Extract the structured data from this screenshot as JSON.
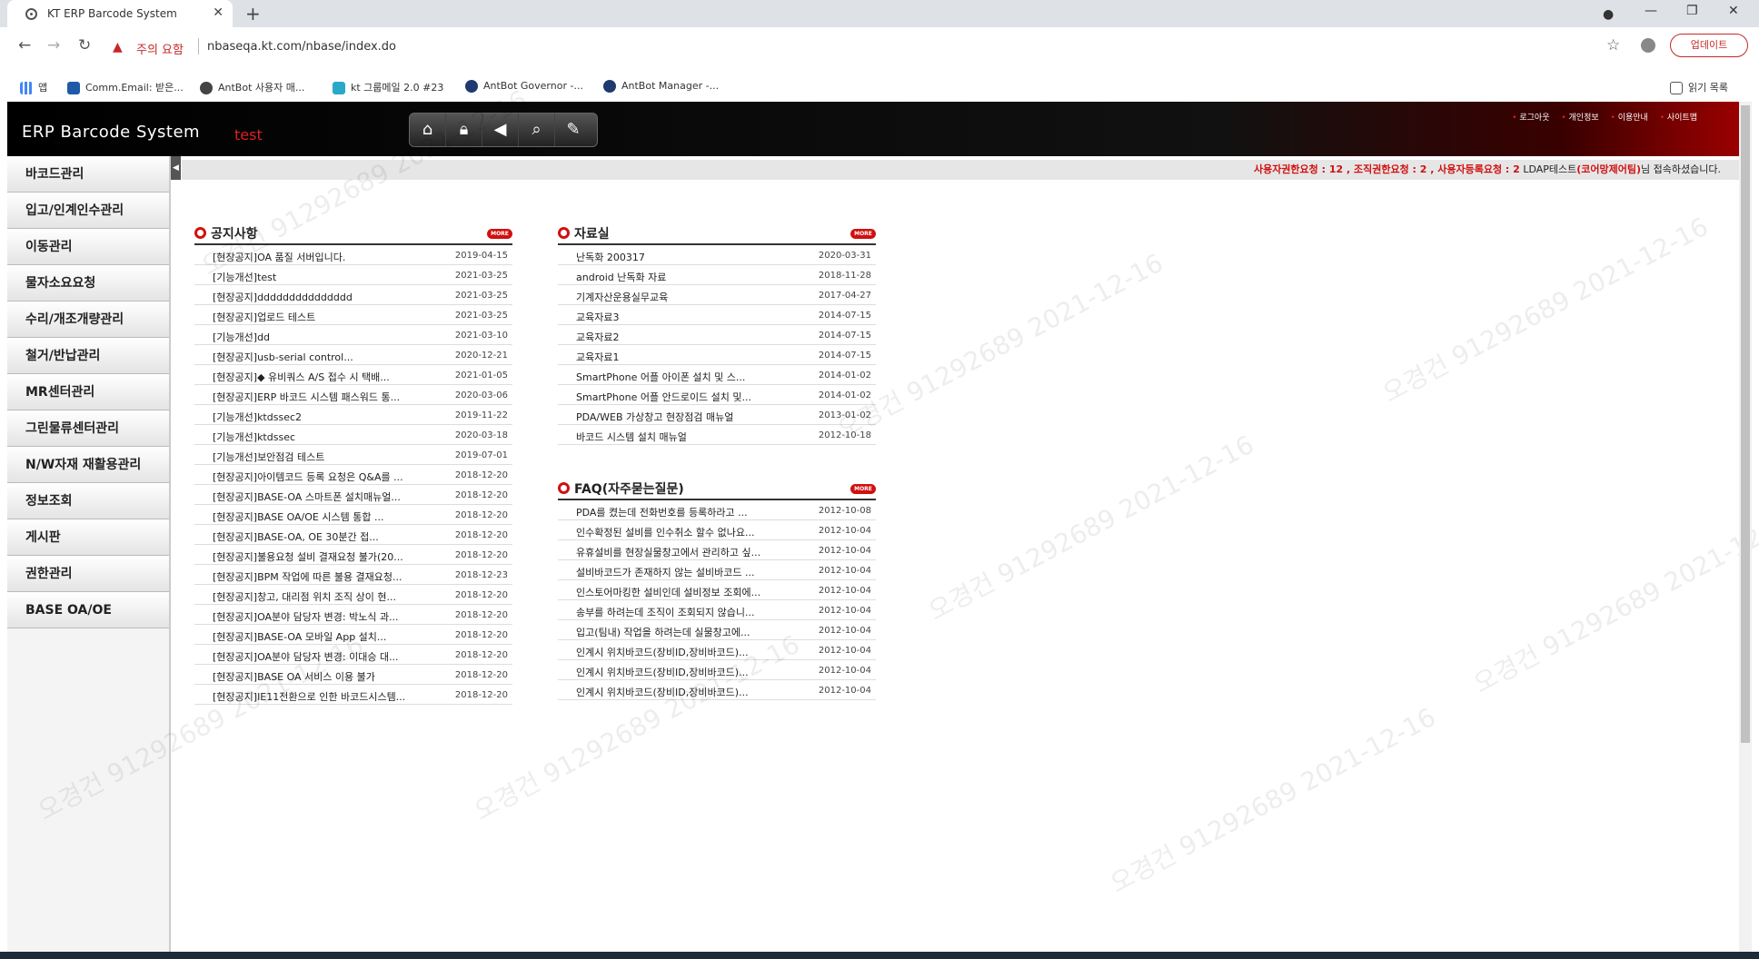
{
  "browser": {
    "tab_title": "KT ERP Barcode System",
    "security_warning": "주의 요함",
    "url": "nbaseqa.kt.com/nbase/index.do",
    "update_button": "업데이트",
    "bookmarks": [
      {
        "label": "앱",
        "icon": "apps-grid-icon"
      },
      {
        "label": "Comm.Email: 받은...",
        "icon": "zimbra-icon"
      },
      {
        "label": "AntBot 사용자 매...",
        "icon": "antbot-icon"
      },
      {
        "label": "kt 그룹메일 2.0 #23",
        "icon": "kt-mail-icon"
      },
      {
        "label": "AntBot Governor -...",
        "icon": "antbot-icon"
      },
      {
        "label": "AntBot Manager -...",
        "icon": "antbot-icon"
      }
    ],
    "reading_list": "읽기 목록"
  },
  "header": {
    "title": "ERP Barcode System",
    "env": "test",
    "top_links": [
      "로그아웃",
      "개인정보",
      "이용안내",
      "사이트맵"
    ]
  },
  "infobar": {
    "requests": "사용자권한요청 : 12 , 조직권한요청 : 2 , 사용자등록요청 : 2",
    "user": "LDAP테스트",
    "user_org": "(코어망제어팀)",
    "suffix": "님 접속하셨습니다."
  },
  "sidebar": {
    "items": [
      "바코드관리",
      "입고/인계인수관리",
      "이동관리",
      "물자소요요청",
      "수리/개조개량관리",
      "철거/반납관리",
      "MR센터관리",
      "그린물류센터관리",
      "N/W자재 재활용관리",
      "정보조회",
      "게시판",
      "권한관리",
      "BASE OA/OE"
    ]
  },
  "notice": {
    "title": "공지사항",
    "more": "MORE",
    "rows": [
      {
        "title": "[현장공지]OA 품질 서버입니다.",
        "date": "2019-04-15"
      },
      {
        "title": "[기능개선]test",
        "date": "2021-03-25"
      },
      {
        "title": "[현장공지]ddddddddddddddd",
        "date": "2021-03-25"
      },
      {
        "title": "[현장공지]업로드 테스트",
        "date": "2021-03-25"
      },
      {
        "title": "[기능개선]dd",
        "date": "2021-03-10"
      },
      {
        "title": "[현장공지]usb-serial control...",
        "date": "2020-12-21"
      },
      {
        "title": "[현장공지]◆ 유비쿼스 A/S 접수 시 택배...",
        "date": "2021-01-05"
      },
      {
        "title": "[현장공지]ERP 바코드 시스템 패스워드 통...",
        "date": "2020-03-06"
      },
      {
        "title": "[기능개선]ktdssec2",
        "date": "2019-11-22"
      },
      {
        "title": "[기능개선]ktdssec",
        "date": "2020-03-18"
      },
      {
        "title": "[기능개선]보안점검 테스트",
        "date": "2019-07-01"
      },
      {
        "title": "[현장공지]아이템코드 등록 요청은 Q&A를 ...",
        "date": "2018-12-20"
      },
      {
        "title": "[현장공지]BASE-OA 스마트폰 설치매뉴얼...",
        "date": "2018-12-20"
      },
      {
        "title": "[현장공지]BASE OA/OE 시스템 통합 ...",
        "date": "2018-12-20"
      },
      {
        "title": "[현장공지]BASE-OA, OE 30분간 접...",
        "date": "2018-12-20"
      },
      {
        "title": "[현장공지]불용요청 설비 결재요청 불가(20...",
        "date": "2018-12-20"
      },
      {
        "title": "[현장공지]BPM 작업에 따른 불용 결재요청...",
        "date": "2018-12-23"
      },
      {
        "title": "[현장공지]창고, 대리점 위치 조직 상이 현...",
        "date": "2018-12-20"
      },
      {
        "title": "[현장공지]OA분야 담당자 변경: 박노식 과...",
        "date": "2018-12-20"
      },
      {
        "title": "[현장공지]BASE-OA 모바일 App 설치...",
        "date": "2018-12-20"
      },
      {
        "title": "[현장공지]OA분야 담당자 변경: 이대승 대...",
        "date": "2018-12-20"
      },
      {
        "title": "[현장공지]BASE OA 서비스 이용 불가",
        "date": "2018-12-20"
      },
      {
        "title": "[현장공지]IE11전환으로 인한 바코드시스템...",
        "date": "2018-12-20"
      }
    ]
  },
  "archive": {
    "title": "자료실",
    "more": "MORE",
    "rows": [
      {
        "title": "난독화 200317",
        "date": "2020-03-31"
      },
      {
        "title": "android 난독화 자료",
        "date": "2018-11-28"
      },
      {
        "title": "기계자산운용실무교육",
        "date": "2017-04-27"
      },
      {
        "title": "교육자료3",
        "date": "2014-07-15"
      },
      {
        "title": "교육자료2",
        "date": "2014-07-15"
      },
      {
        "title": "교육자료1",
        "date": "2014-07-15"
      },
      {
        "title": "SmartPhone 어플 아이폰 설치 및 스...",
        "date": "2014-01-02"
      },
      {
        "title": "SmartPhone 어플 안드로이드 설치 및...",
        "date": "2014-01-02"
      },
      {
        "title": "PDA/WEB 가상창고 현장점검 매뉴얼",
        "date": "2013-01-02"
      },
      {
        "title": "바코드 시스템 설치 매뉴얼",
        "date": "2012-10-18"
      }
    ]
  },
  "faq": {
    "title": "FAQ(자주묻는질문)",
    "more": "MORE",
    "rows": [
      {
        "title": "PDA를 켰는데 전화번호를 등록하라고 ...",
        "date": "2012-10-08"
      },
      {
        "title": "인수확정된 설비를 인수취소 할수 없나요...",
        "date": "2012-10-04"
      },
      {
        "title": "유휴설비를 현장실물창고에서 관리하고 싶...",
        "date": "2012-10-04"
      },
      {
        "title": "설비바코드가 존재하지 않는 설비바코드 ...",
        "date": "2012-10-04"
      },
      {
        "title": "인스토어마킹한 설비인데 설비정보 조회에...",
        "date": "2012-10-04"
      },
      {
        "title": "송부를 하려는데 조직이 조회되지 않습니...",
        "date": "2012-10-04"
      },
      {
        "title": "입고(팀내) 작업을 하려는데 실물창고에...",
        "date": "2012-10-04"
      },
      {
        "title": "인계시 위치바코드(장비ID,장비바코드)...",
        "date": "2012-10-04"
      },
      {
        "title": "인계시 위치바코드(장비ID,장비바코드)...",
        "date": "2012-10-04"
      },
      {
        "title": "인계시 위치바코드(장비ID,장비바코드)...",
        "date": "2012-10-04"
      }
    ]
  },
  "watermark": {
    "text": "오경건  91292689  2021-12-16"
  }
}
